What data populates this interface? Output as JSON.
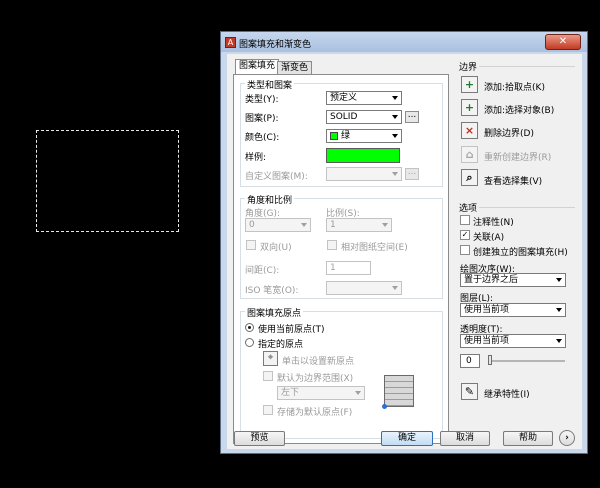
{
  "dialog": {
    "title": "图案填充和渐变色",
    "close_label": "✕",
    "tabs": [
      "图案填充",
      "渐变色"
    ],
    "type_pattern": {
      "title": "类型和图案",
      "type_label": "类型(Y):",
      "type_value": "预定义",
      "pattern_label": "图案(P):",
      "pattern_value": "SOLID",
      "color_label": "颜色(C):",
      "color_value": "绿",
      "swatch_label": "样例:",
      "custom_label": "自定义图案(M):",
      "dots": "...",
      "swatch_color": "#00ff00"
    },
    "angle_scale": {
      "title": "角度和比例",
      "angle_label": "角度(G):",
      "angle_value": "0",
      "scale_label": "比例(S):",
      "scale_value": "1",
      "double_label": "双向(U)",
      "relative_label": "相对图纸空间(E)",
      "spacing_label": "间距(C):",
      "spacing_value": "1",
      "iso_label": "ISO 笔宽(O):"
    },
    "origin": {
      "title": "图案填充原点",
      "current_label": "使用当前原点(T)",
      "specified_label": "指定的原点",
      "click_label": "单击以设置新原点",
      "default_extent_label": "默认为边界范围(X)",
      "extent_value": "左下",
      "store_label": "存储为默认原点(F)"
    },
    "boundaries": {
      "title": "边界",
      "add_pick_label": "添加:拾取点(K)",
      "add_select_label": "添加:选择对象(B)",
      "remove_label": "删除边界(D)",
      "recreate_label": "重新创建边界(R)",
      "view_label": "查看选择集(V)"
    },
    "options": {
      "title": "选项",
      "annotative_label": "注释性(N)",
      "associative_label": "关联(A)",
      "separate_label": "创建独立的图案填充(H)",
      "draw_order_label": "绘图次序(W):",
      "draw_order_value": "置于边界之后",
      "layer_label": "图层(L):",
      "layer_value": "使用当前项",
      "transparency_label": "透明度(T):",
      "transparency_value": "使用当前项",
      "transparency_number": "0"
    },
    "inherit_label": "继承特性(I)",
    "buttons": {
      "preview": "预览",
      "ok": "确定",
      "cancel": "取消",
      "help": "帮助",
      "more": "›"
    }
  }
}
